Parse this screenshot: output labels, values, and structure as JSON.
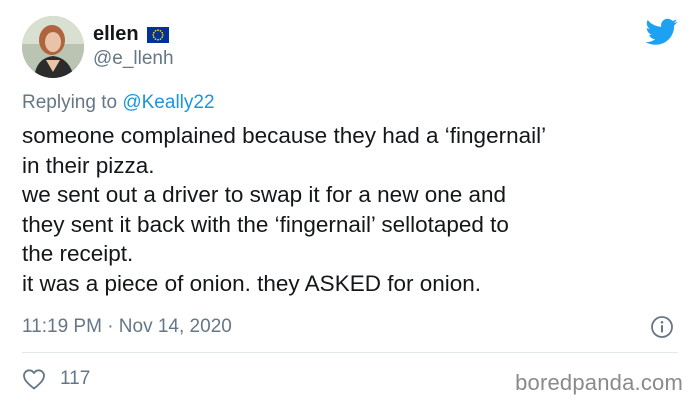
{
  "author": {
    "display_name": "ellen",
    "handle": "@e_llenh",
    "avatar_icon": "profile-photo",
    "badge_icon": "eu-flag-icon"
  },
  "reply": {
    "prefix": "Replying to",
    "mention": "@Keally22"
  },
  "tweet": {
    "lines": [
      "someone complained because they had a ‘fingernail’",
      "in their pizza.",
      "we sent out a driver to swap it for a new one and",
      "they sent it back with the ‘fingernail’ sellotaped to",
      "the receipt.",
      "it was a piece of onion. they ASKED for onion."
    ]
  },
  "meta": {
    "timestamp": "11:19 PM · Nov 14, 2020"
  },
  "actions": {
    "like_count": "117"
  },
  "watermark": "boredpanda.com",
  "colors": {
    "twitter_blue": "#1da1f2",
    "link_blue": "#1b95e0",
    "muted_gray": "#657786",
    "eu_blue": "#003399",
    "eu_yellow": "#ffcc00"
  }
}
